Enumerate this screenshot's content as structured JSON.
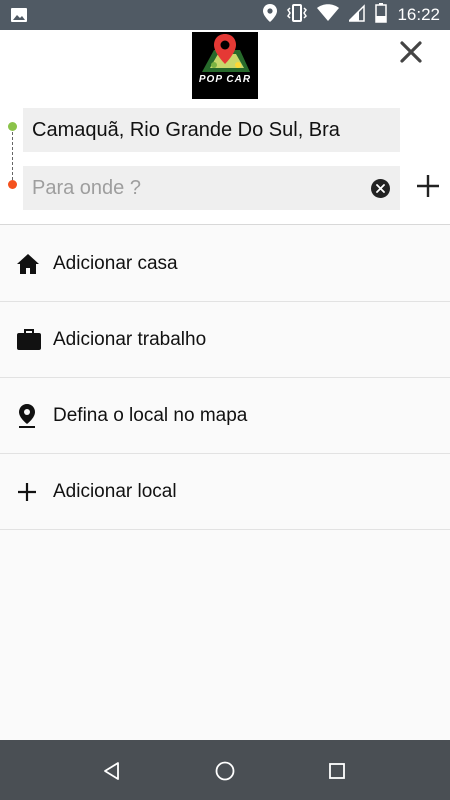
{
  "status_bar": {
    "time": "16:22",
    "icons": [
      "image-icon",
      "location-icon",
      "vibrate-icon",
      "wifi-icon",
      "signal-icon",
      "battery-icon"
    ]
  },
  "header": {
    "logo_text": "POP CAR",
    "close_icon": "close-icon",
    "origin_value": "Camaquã, Rio Grande Do Sul, Bra",
    "destination_placeholder": "Para onde ?",
    "destination_value": "",
    "colors": {
      "origin_dot": "#8bc34a",
      "destination_dot": "#f4511e",
      "field_bg": "#efefef"
    }
  },
  "list": {
    "items": [
      {
        "label": "Adicionar casa",
        "icon": "home-icon"
      },
      {
        "label": "Adicionar trabalho",
        "icon": "briefcase-icon"
      },
      {
        "label": "Defina o local no mapa",
        "icon": "map-pin-icon"
      },
      {
        "label": "Adicionar local",
        "icon": "plus-icon"
      }
    ]
  },
  "nav_bar": {
    "buttons": [
      "back-icon",
      "home-circle-icon",
      "recents-icon"
    ]
  }
}
